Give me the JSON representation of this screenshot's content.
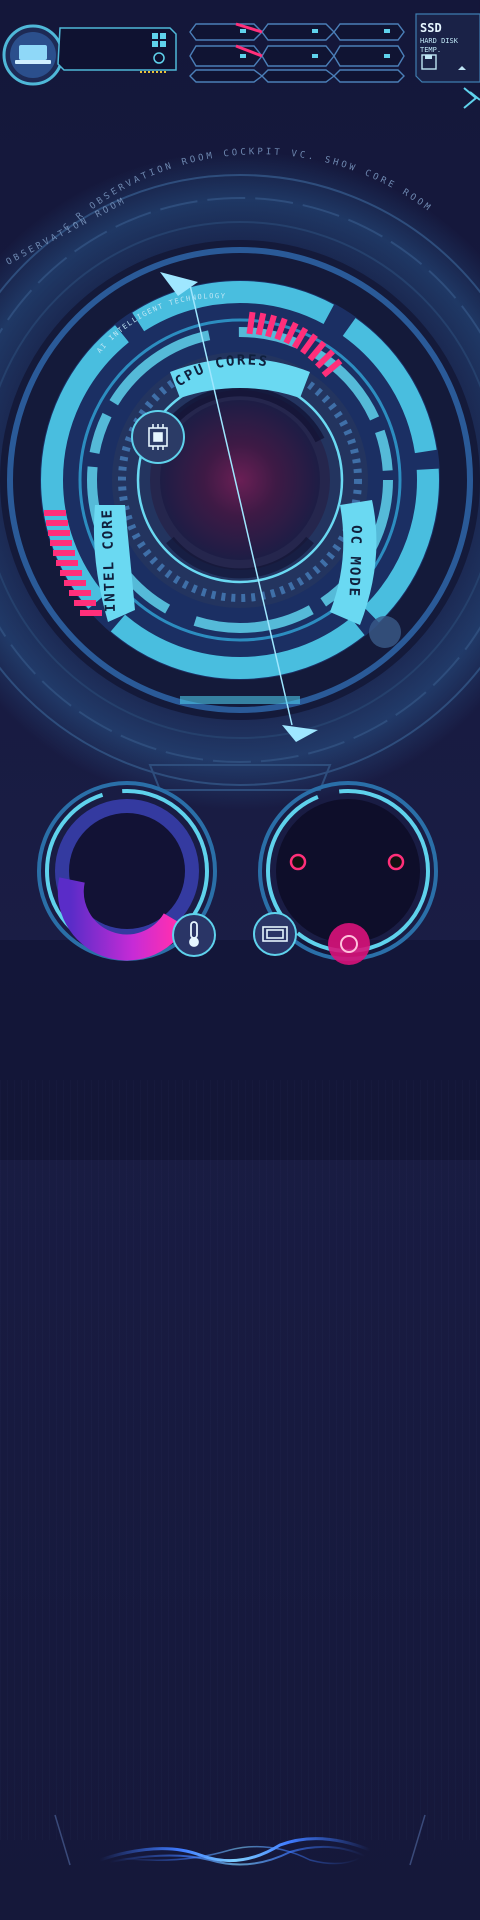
{
  "header": {
    "ssd": "SSD",
    "hard_disk_label": "HARD DISK",
    "temp_label": "TEMP."
  },
  "ring": {
    "outer_text": "C.R OBSERVATION ROOM COCKPIT VC. SHOW CORE ROOM",
    "outer_left_text": "OBSERVATION ROOM",
    "inner_top_text": "AI INTELLIGENT TECHNOLOGY",
    "cpu_cores": "CPU CORES",
    "intel_core": "INTEL CORE",
    "oc_mode": "OC MODE"
  },
  "gauges": {
    "temperature_level": 0.35
  },
  "colors": {
    "accent_cyan": "#5fd2ec",
    "accent_pink": "#ff2f7a",
    "accent_purple": "#b02bd8",
    "background": "#171a40"
  },
  "icons": {
    "profile": "laptop-icon",
    "processor": "cpu-chip-icon",
    "temperature": "thermometer-icon",
    "memory": "memory-icon",
    "disk": "floppy-icon",
    "power": "power-icon"
  }
}
